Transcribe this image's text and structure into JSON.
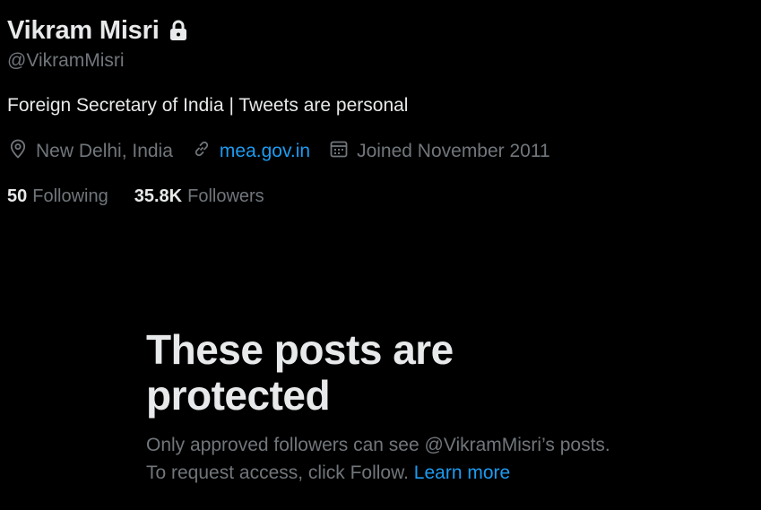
{
  "profile": {
    "display_name": "Vikram Misri",
    "handle": "@VikramMisri",
    "bio": "Foreign Secretary of India | Tweets are personal",
    "location": "New Delhi, India",
    "website": "mea.gov.in",
    "joined": "Joined November 2011",
    "following_count": "50",
    "following_label": "Following",
    "followers_count": "35.8K",
    "followers_label": "Followers",
    "lock_icon": "lock-icon"
  },
  "protected_notice": {
    "title": "These posts are protected",
    "description": "Only approved followers can see @VikramMisri’s posts. To request access, click Follow.",
    "learn_more": "Learn more"
  },
  "colors": {
    "background": "#000000",
    "primary_text": "#e7e9ea",
    "secondary_text": "#71767b",
    "accent": "#1d9bf0"
  }
}
